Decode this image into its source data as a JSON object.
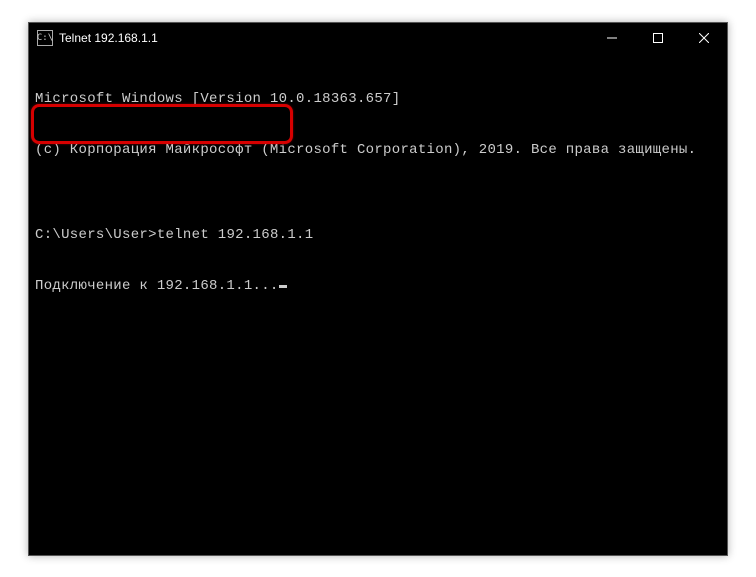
{
  "titlebar": {
    "icon_text": "C:\\",
    "title": "Telnet 192.168.1.1"
  },
  "console": {
    "line1": "Microsoft Windows [Version 10.0.18363.657]",
    "line2": "(c) Корпорация Майкрософт (Microsoft Corporation), 2019. Все права защищены.",
    "line3": "",
    "prompt": "C:\\Users\\User>",
    "command": "telnet 192.168.1.1",
    "status": "Подключение к 192.168.1.1..."
  }
}
